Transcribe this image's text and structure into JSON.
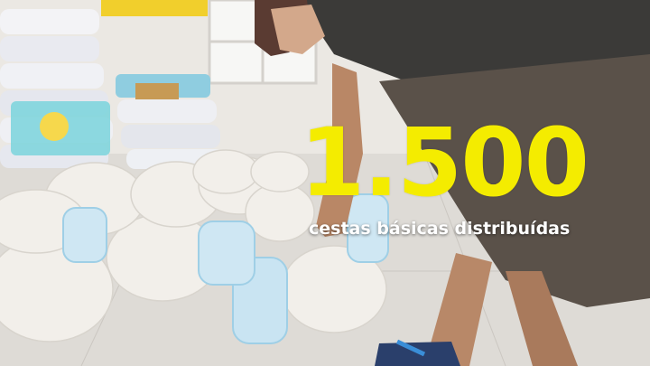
{
  "overlay": {
    "big_number": "1.500",
    "caption": "cestas básicas distribuídas",
    "number_color": "#f4ec00",
    "caption_color": "#ffffff"
  },
  "scene": {
    "description_icons": [
      "food-basket-bag",
      "diaper-pack",
      "person-bending"
    ]
  }
}
